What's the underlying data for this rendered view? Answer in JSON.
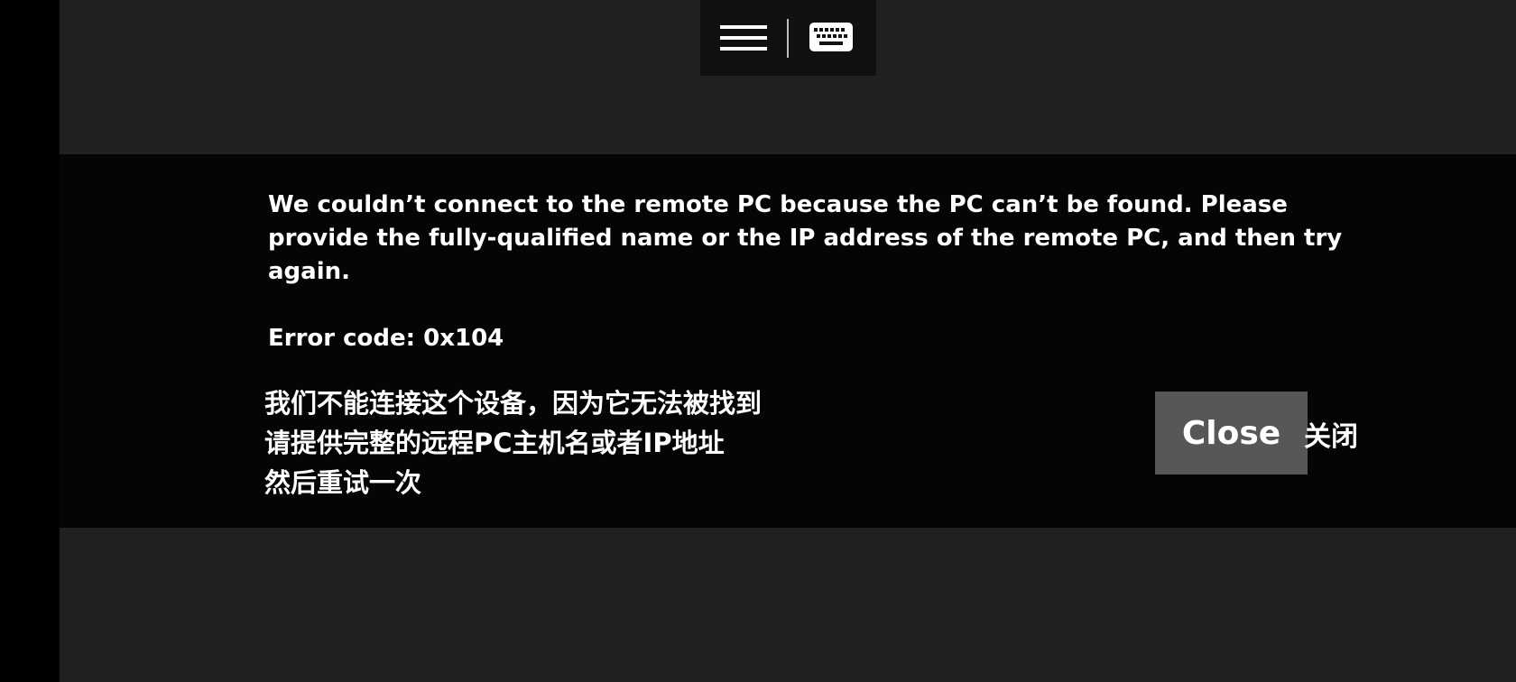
{
  "session_bar": {
    "menu_icon": "hamburger-menu-icon",
    "keyboard_icon": "keyboard-icon"
  },
  "dialog": {
    "message": "We couldn’t connect to the remote PC because the PC can’t be found. Please provide the fully-qualified name or the IP address of the remote PC, and then try again.",
    "error_code": "Error code: 0x104",
    "chinese_lines": [
      "我们不能连接这个设备，因为它无法被找到",
      "请提供完整的远程PC主机名或者IP地址",
      "然后重试一次"
    ],
    "close_label": "Close",
    "close_label_cn": "关闭"
  },
  "colors": {
    "background": "#202020",
    "dialog_background": "#050505",
    "close_button": "#575757",
    "text": "#ffffff"
  }
}
